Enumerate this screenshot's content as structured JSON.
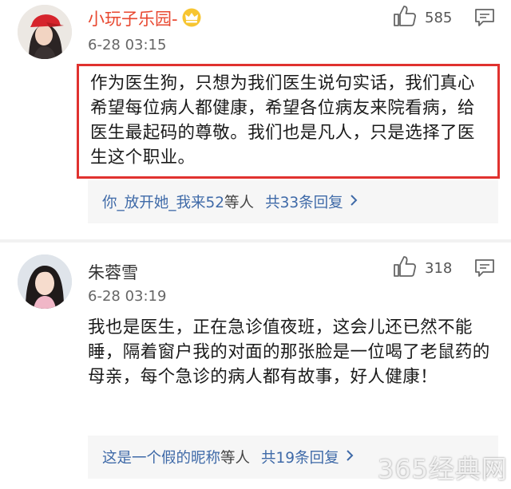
{
  "comments": [
    {
      "username": "小玩子乐园-",
      "badge_icon": "crown-icon",
      "time": "6-28 03:15",
      "likes": "585",
      "text": "作为医生狗，只想为我们医生说句实话，我们真心希望每位病人都健康，希望各位病友来院看病，给医生最起码的尊敬。我们也是凡人，只是选择了医生这个职业。",
      "reply_user": "你_放开她_我来52",
      "reply_suffix": "等人",
      "reply_count": "共33条回复"
    },
    {
      "username": "朱蓉雪",
      "time": "6-28 03:19",
      "likes": "318",
      "text": "我也是医生，正在急诊值夜班，这会儿还已然不能睡，隔着窗户我的对面的那张脸是一位喝了老鼠药的母亲，每个急诊的病人都有故事，好人健康！",
      "reply_user": "这是一个假的昵称",
      "reply_suffix": "等人",
      "reply_count": "共19条回复"
    }
  ],
  "watermark": "365经典网",
  "colors": {
    "highlight_border": "#e0322f",
    "username_vip": "#e8472f",
    "link": "#3f6aa8"
  }
}
